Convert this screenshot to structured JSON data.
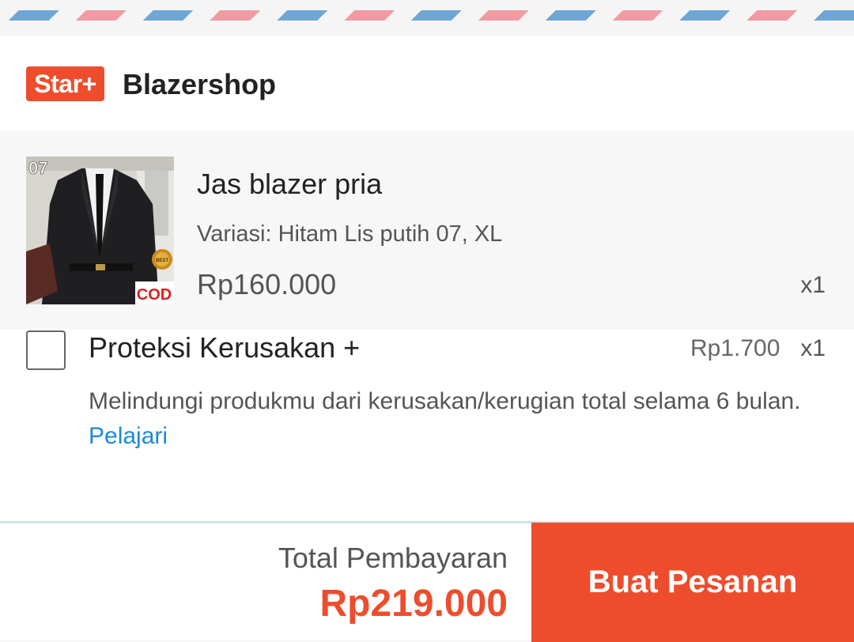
{
  "shop": {
    "badge": "Star+",
    "name": "Blazershop"
  },
  "product": {
    "name": "Jas blazer pria",
    "variant": "Variasi: Hitam Lis putih 07, XL",
    "price": "Rp160.000",
    "quantity": "x1",
    "thumbnail": {
      "corner_label": "07",
      "stamp_label": "COD",
      "seal_label": "BEST"
    }
  },
  "protection": {
    "title": "Proteksi Kerusakan +",
    "price": "Rp1.700",
    "quantity": "x1",
    "description": "Melindungi produkmu dari kerusakan/kerugian total selama 6 bulan.",
    "link_label": "Pelajari",
    "checked": false
  },
  "checkout": {
    "total_label": "Total Pembayaran",
    "total_value": "Rp219.000",
    "button_label": "Buat Pesanan"
  },
  "colors": {
    "accent": "#ee4d2d",
    "link": "#1a8ad8"
  }
}
